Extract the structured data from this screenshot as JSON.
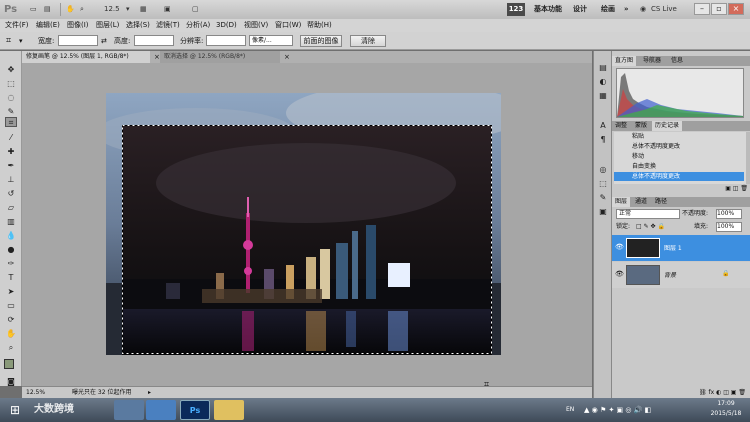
{
  "app": {
    "logo": "Ps",
    "zoom": "12.5",
    "workspace_badge": "123",
    "workspace_links": [
      "基本功能",
      "设计",
      "绘画"
    ],
    "more": "»",
    "cs_live": "CS Live"
  },
  "menu": [
    "文件(F)",
    "编辑(E)",
    "图像(I)",
    "图层(L)",
    "选择(S)",
    "滤镜(T)",
    "分析(A)",
    "3D(D)",
    "视图(V)",
    "窗口(W)",
    "帮助(H)"
  ],
  "options": {
    "width_label": "宽度:",
    "height_label": "高度:",
    "resolution_label": "分辨率:",
    "unit": "像素/...",
    "front_image": "前面的图像",
    "clear": "清除"
  },
  "doc_tabs": [
    "修复画笔 @ 12.5% (图层 1, RGB/8*)",
    "取消选择 @ 12.5% (RGB/8*)"
  ],
  "status": {
    "zoom": "12.5%",
    "info": "曝光只在 32 位起作用"
  },
  "panels": {
    "histogram_tabs": [
      "直方图",
      "导航器",
      "信息"
    ],
    "history_tabs": [
      "调整",
      "蒙版",
      "历史记录"
    ],
    "history_items": [
      "粘贴",
      "总体不透明度更改",
      "移动",
      "自由变换",
      "总体不透明度更改"
    ],
    "layers_tabs": [
      "图层",
      "通道",
      "路径"
    ],
    "blend_mode": "正常",
    "opacity_label": "不透明度:",
    "opacity": "100%",
    "lock_label": "锁定:",
    "fill_label": "填充:",
    "fill": "100%",
    "layers": [
      "图层 1",
      "背景"
    ]
  },
  "taskbar": {
    "watermark": "大数跨境",
    "tray_lang": "EN",
    "time": "17:09",
    "date": "2015/5/18"
  },
  "colors": {
    "selected": "#3d8fe0",
    "panel": "#c9c9c9"
  }
}
